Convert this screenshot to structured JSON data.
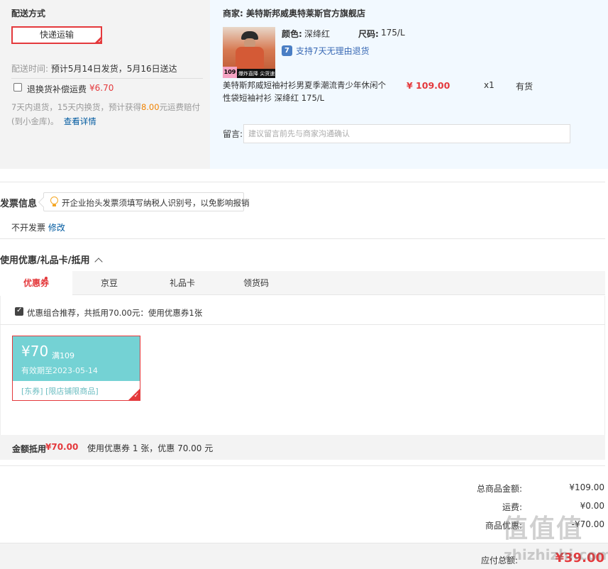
{
  "shipping": {
    "title": "配送方式",
    "method": "快递运输",
    "time_label": "配送时间:",
    "time_value": "预计5月14日发货，5月16日送达",
    "insurance_label": "退换货补偿运费",
    "insurance_price": "¥6.70",
    "insurance_desc_pre": "7天内退货，15天内换货，预计获得",
    "insurance_desc_amt": "8.00",
    "insurance_desc_post": "元运费赔付(到小金库)。",
    "insurance_link": "查看详情"
  },
  "merchant": {
    "shop": "商家:  美特斯邦威奥特莱斯官方旗舰店",
    "color_label": "颜色:",
    "color_value": "深绛红",
    "size_label": "尺码:",
    "size_value": "175/L",
    "return_badge": "7",
    "return_text": "支持7天无理由退货",
    "image_tag_price": "109",
    "image_tag_text": "爆炸直降 尖货速抢",
    "product_name": "美特斯邦威短袖衬衫男夏季潮流青少年休闲个性袋短袖衬衫 深绛红 175/L",
    "price": "¥ 109.00",
    "quantity": "x1",
    "stock": "有货",
    "message_label": "留言:",
    "message_placeholder": "建议留言前先与商家沟通确认"
  },
  "invoice": {
    "title": "发票信息",
    "tip": "开企业抬头发票须填写纳税人识别号，以免影响报销",
    "status": "不开发票",
    "edit": "修改"
  },
  "coupons": {
    "title": "使用优惠/礼品卡/抵用",
    "tabs": [
      "优惠券",
      "京豆",
      "礼品卡",
      "领货码"
    ],
    "combo_text": "优惠组合推荐，共抵用70.00元：使用优惠券1张",
    "coupon": {
      "amount": "¥70",
      "condition": "满109",
      "expiry": "有效期至2023-05-14",
      "tags": "[东券]  [限店铺限商品]"
    },
    "deduct_label": "金额抵用",
    "deduct_amount": "¥70.00",
    "deduct_desc": "使用优惠券 1 张，优惠 70.00 元"
  },
  "summary": {
    "goods_label": "总商品金额:",
    "goods_value": "¥109.00",
    "freight_label": "运费:",
    "freight_value": "¥0.00",
    "discount_label": "商品优惠:",
    "discount_value": "-¥70.00",
    "total_label": "应付总额:",
    "total_value": "¥39.00"
  },
  "watermark": {
    "mark": "值值值",
    "site": "zhizhizhi.com"
  },
  "colors": {
    "accent": "#e4393c",
    "coupon": "#74d2d4",
    "link": "#005aa0",
    "orange": "#f08200"
  }
}
